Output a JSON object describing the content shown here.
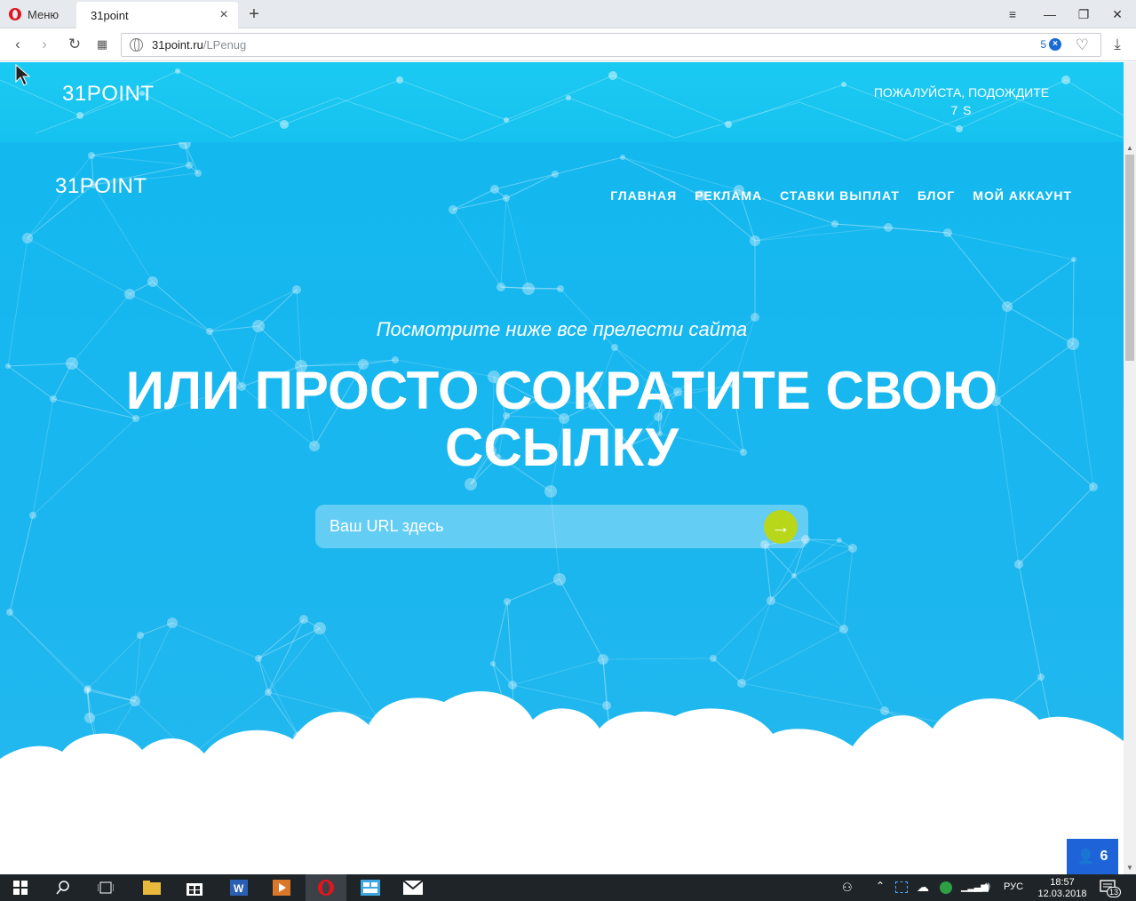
{
  "browser": {
    "menu_label": "Меню",
    "tab_title": "31point",
    "url_domain": "31point.ru",
    "url_path": "/LPenug",
    "blocked_count": "5"
  },
  "topbar": {
    "logo": "31POINT",
    "wait_label": "ПОЖАЛУЙСТА, ПОДОЖДИТЕ",
    "wait_seconds": "7 S"
  },
  "hero": {
    "logo": "31POINT",
    "nav": [
      "ГЛАВНАЯ",
      "РЕКЛАМА",
      "СТАВКИ ВЫПЛАТ",
      "БЛОГ",
      "МОЙ АККАУНТ"
    ],
    "tagline": "Посмотрите ниже все прелести сайта",
    "headline_line1": "ИЛИ ПРОСТО СОКРАТИТЕ СВОЮ",
    "headline_line2": "ССЫЛКУ",
    "url_placeholder": "Ваш URL здесь"
  },
  "users_badge": {
    "count": "6"
  },
  "taskbar": {
    "language": "РУС",
    "time": "18:57",
    "date": "12.03.2018",
    "notifications": "13"
  },
  "colors": {
    "hero_blue": "#18b9ef",
    "accent_green": "#b8d61a",
    "badge_blue": "#1e64d8"
  }
}
